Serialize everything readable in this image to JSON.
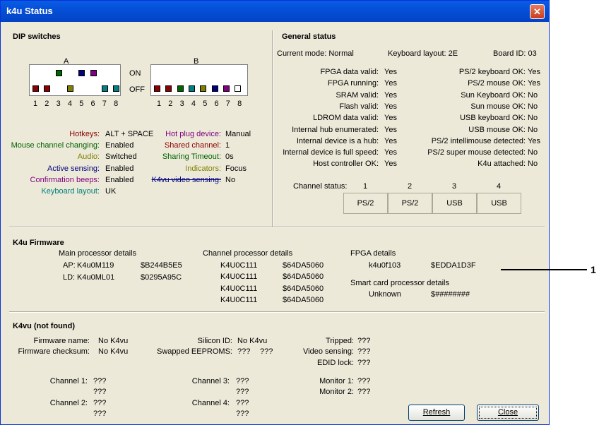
{
  "title": "k4u Status",
  "colors": {
    "red": "#8b0000",
    "green": "#006400",
    "olive": "#808000",
    "navy": "#000080",
    "purple": "#800080",
    "teal": "#008080",
    "white": "#ffffff"
  },
  "dip": {
    "heading": "DIP switches",
    "label_a": "A",
    "label_b": "B",
    "on": "ON",
    "off": "OFF",
    "numbers": [
      "1",
      "2",
      "3",
      "4",
      "5",
      "6",
      "7",
      "8"
    ],
    "a_states": [
      "off",
      "off",
      "on",
      "off",
      "on",
      "on",
      "off",
      "off"
    ],
    "a_colors": [
      "red",
      "red",
      "green",
      "olive",
      "navy",
      "purple",
      "teal",
      "teal"
    ],
    "b_states": [
      "off",
      "off",
      "off",
      "off",
      "off",
      "off",
      "off",
      "off"
    ],
    "b_colors": [
      "red",
      "red",
      "green",
      "teal",
      "olive",
      "navy",
      "purple",
      "white"
    ]
  },
  "dip_settings": {
    "hotkeys": {
      "label": "Hotkeys:",
      "value": "ALT + SPACE"
    },
    "mouse_channel": {
      "label": "Mouse channel changing:",
      "value": "Enabled"
    },
    "audio": {
      "label": "Audio:",
      "value": "Switched"
    },
    "active_sensing": {
      "label": "Active sensing:",
      "value": "Enabled"
    },
    "confirmation": {
      "label": "Confirmation beeps:",
      "value": "Enabled"
    },
    "keyboard_layout": {
      "label": "Keyboard layout:",
      "value": "UK"
    },
    "hot_plug": {
      "label": "Hot plug device:",
      "value": "Manual"
    },
    "shared_channel": {
      "label": "Shared channel:",
      "value": "1"
    },
    "sharing_timeout": {
      "label": "Sharing Timeout:",
      "value": "0s"
    },
    "indicators": {
      "label": "Indicators:",
      "value": "Focus"
    },
    "k4vu_video": {
      "label": "K4vu video sensing:",
      "value": "No"
    }
  },
  "general": {
    "heading": "General status",
    "current_mode": "Current mode:  Normal",
    "keyboard_layout": "Keyboard layout:  2E",
    "board_id": "Board ID: 03",
    "left": [
      {
        "label": "FPGA data valid:",
        "value": "Yes"
      },
      {
        "label": "FPGA running:",
        "value": "Yes"
      },
      {
        "label": "SRAM valid:",
        "value": "Yes"
      },
      {
        "label": "Flash valid:",
        "value": "Yes"
      },
      {
        "label": "LDROM data valid:",
        "value": "Yes"
      },
      {
        "label": "Internal hub enumerated:",
        "value": "Yes"
      },
      {
        "label": "Internal device is a hub:",
        "value": "Yes"
      },
      {
        "label": "Internal device is full speed:",
        "value": "Yes"
      },
      {
        "label": "Host controller OK:",
        "value": "Yes"
      }
    ],
    "right": [
      {
        "label": "PS/2 keyboard OK:",
        "value": "Yes"
      },
      {
        "label": "PS/2 mouse OK:",
        "value": "Yes"
      },
      {
        "label": "Sun Keyboard OK:",
        "value": "No"
      },
      {
        "label": "Sun mouse OK:",
        "value": "No"
      },
      {
        "label": "USB keyboard OK:",
        "value": "No"
      },
      {
        "label": "USB mouse OK:",
        "value": "No"
      },
      {
        "label": "PS/2 intellimouse detected:",
        "value": "Yes"
      },
      {
        "label": "PS/2 super mouse detected:",
        "value": "No"
      },
      {
        "label": "K4u attached:",
        "value": "No"
      }
    ],
    "channel_status_label": "Channel status:",
    "channels": [
      "1",
      "2",
      "3",
      "4"
    ],
    "channel_values": [
      "PS/2",
      "PS/2",
      "USB",
      "USB"
    ]
  },
  "firmware": {
    "heading": "K4u Firmware",
    "main_heading": "Main processor details",
    "ap_label": "AP:",
    "ap_name": "K4u0M119",
    "ap_hash": "$B244B5E5",
    "ld_label": "LD:",
    "ld_name": "K4u0ML01",
    "ld_hash": "$0295A95C",
    "channel_heading": "Channel processor details",
    "channel_rows": [
      {
        "name": "K4U0C111",
        "hash": "$64DA5060"
      },
      {
        "name": "K4U0C111",
        "hash": "$64DA5060"
      },
      {
        "name": "K4U0C111",
        "hash": "$64DA5060"
      },
      {
        "name": "K4U0C111",
        "hash": "$64DA5060"
      }
    ],
    "fpga_heading": "FPGA details",
    "fpga_name": "k4u0f103",
    "fpga_hash": "$EDDA1D3F",
    "smartcard_heading": "Smart card processor details",
    "smartcard_name": "Unknown",
    "smartcard_hash": "$########"
  },
  "k4vu": {
    "heading": "K4vu (not found)",
    "firmware_name_label": "Firmware name:",
    "firmware_name": "No K4vu",
    "firmware_checksum_label": "Firmware checksum:",
    "firmware_checksum": "No K4vu",
    "silicon_label": "Silicon ID:",
    "silicon": "No K4vu",
    "swapped_label": "Swapped EEPROMS:",
    "swapped_1": "???",
    "swapped_2": "???",
    "tripped_label": "Tripped:",
    "tripped": "???",
    "video_label": "Video sensing:",
    "video": "???",
    "edid_label": "EDID lock:",
    "edid": "???",
    "ch1_label": "Channel 1:",
    "ch2_label": "Channel 2:",
    "ch3_label": "Channel 3:",
    "ch4_label": "Channel 4:",
    "mon1_label": "Monitor 1:",
    "mon2_label": "Monitor 2:",
    "unknown": "???"
  },
  "buttons": {
    "refresh": "Refresh",
    "close": "Close"
  },
  "annotation": "1"
}
